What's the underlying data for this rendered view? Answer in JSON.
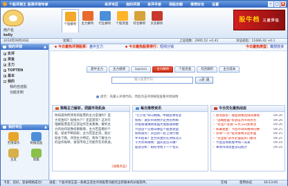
{
  "window": {
    "title": "个股评测王 股票评测专家"
  },
  "menus": [
    "单评专区",
    "我的评测",
    "单评手册",
    "领股份额",
    "推荐好友",
    "设置"
  ],
  "user": {
    "label": "用户名",
    "name": "kelly",
    "logout": "注销"
  },
  "toolbar": [
    {
      "label": "个股解析",
      "color": "#f3a92b",
      "active": true
    },
    {
      "label": "主力解析",
      "color": "#e96a2a"
    },
    {
      "label": "行业解析",
      "color": "#4b8fd8"
    },
    {
      "label": "个股资金",
      "color": "#ffb42b"
    },
    {
      "label": "综合解析",
      "color": "#d6a23a"
    },
    {
      "label": "买卖解析",
      "color": "#c73a2b"
    }
  ],
  "banner": {
    "text": "股牛档",
    "sub": "三度评估"
  },
  "infobar": {
    "date": "2010年09月26日",
    "weekday": "星期二",
    "sh": "上证指数：2995.52 +0.41",
    "sz": "深证成指：11666.42 +0.1"
  },
  "left": {
    "title": "我的评测",
    "tree": [
      {
        "label": "实评",
        "bold": true
      },
      {
        "label": "资金",
        "bold": true
      },
      {
        "label": "主力",
        "bold": true
      },
      {
        "label": "TOPTEN",
        "bold": true
      },
      {
        "label": "基本",
        "bold": true
      },
      {
        "label": "我的",
        "bold": true
      },
      {
        "label": "我的自选股",
        "bold": false
      },
      {
        "label": "功能定制",
        "bold": false
      }
    ],
    "mine_title": "我的专区",
    "mine": [
      {
        "label": "无限操作",
        "color": "#e7a52c"
      },
      {
        "label": "制做选股",
        "color": "#4c8fd8"
      },
      {
        "label": "主友",
        "color": "#d7b04a"
      },
      {
        "label": "图集",
        "color": "#8bbf4a"
      }
    ]
  },
  "main": {
    "today_recommend_label": "今日最热评测股票：",
    "today_recommend_value": "盘中主力",
    "today_hot_label": "今日最热股票排行：",
    "today_hot_value": "短线分钱",
    "today_unsure_label": "今日最热类型：",
    "today_unsure_value": "翼部技资",
    "tabs": [
      {
        "label": "盘中主力"
      },
      {
        "label": "主力规律"
      },
      {
        "label": "topsecs"
      },
      {
        "label": "主力解析",
        "on": true
      },
      {
        "label": "个股资金"
      },
      {
        "label": "综合解析"
      },
      {
        "label": "主力成本"
      }
    ],
    "search_placeholder": "输入股票代码",
    "search_button": "评 测",
    "tip": "提示：先输入评测代码，然后点击评测按钮查看评测详情"
  },
  "cards": [
    {
      "title": "策略主力解析，把握市场机会",
      "lines": [
        "你知道你所持有的股票的主力是谁吗？是",
        "大资金吗？短线大户？还是游资？这对于",
        "理解股票是否正常运作至关重要。解析主",
        "力的动作就像侦察敌情，主力若是看好个",
        "股，就会不断低吸；主力若是出货，股价",
        "就会下跌。评测主力特征，帮你了解主力",
        "的运作规律，发现市场上可能存在的机会。"
      ],
      "more": "[详情点击]"
    },
    {
      "title": "每日推荐资讯",
      "lines": [
        "\"七小龙\"导向明确，中期反弹有望",
        "机构：期货市场预计走势的判断",
        "炒股需谨慎政策面大盘加速调整",
        "节后首个交易日哪些个股会受益",
        "机构观点：开启新一轮上攻行情",
        "牛市结束？主力资金仍在持续流入",
        "十大券商策略：国庆后怎么做？",
        "股票分析：如何寻找下一个龙头"
      ]
    },
    {
      "title": "今日优化最热动态",
      "items": [
        {
          "text": "鼎龙股份：收益调整后值得重视",
          "date": "09-26"
        },
        {
          "text": "\"远端配置\"有望成为市场热点",
          "date": "09-26"
        },
        {
          "text": "\"农业产业链\"三大方向受关注",
          "date": "09-26"
        },
        {
          "text": "私募基金：节后市场风格将切换",
          "date": "09-25"
        },
        {
          "text": "券商\"一年\"投资策略浮出水面",
          "date": "09-25"
        },
        {
          "text": "\"农业股\"逆市走强成热门板块",
          "date": "09-25"
        },
        {
          "text": "节后首周新股申购一览表",
          "date": "09-24"
        },
        {
          "text": "本周市场资金流向统计",
          "date": "09-24"
        }
      ]
    }
  ],
  "status": {
    "left": "卡友：您好，登录网络成功！",
    "mid": "进度：个股评测王是一款真正适合评测股票功能的全新版本的炒股软件。",
    "online": "在线",
    "right": "使用协议",
    "time": "16:13:05"
  }
}
